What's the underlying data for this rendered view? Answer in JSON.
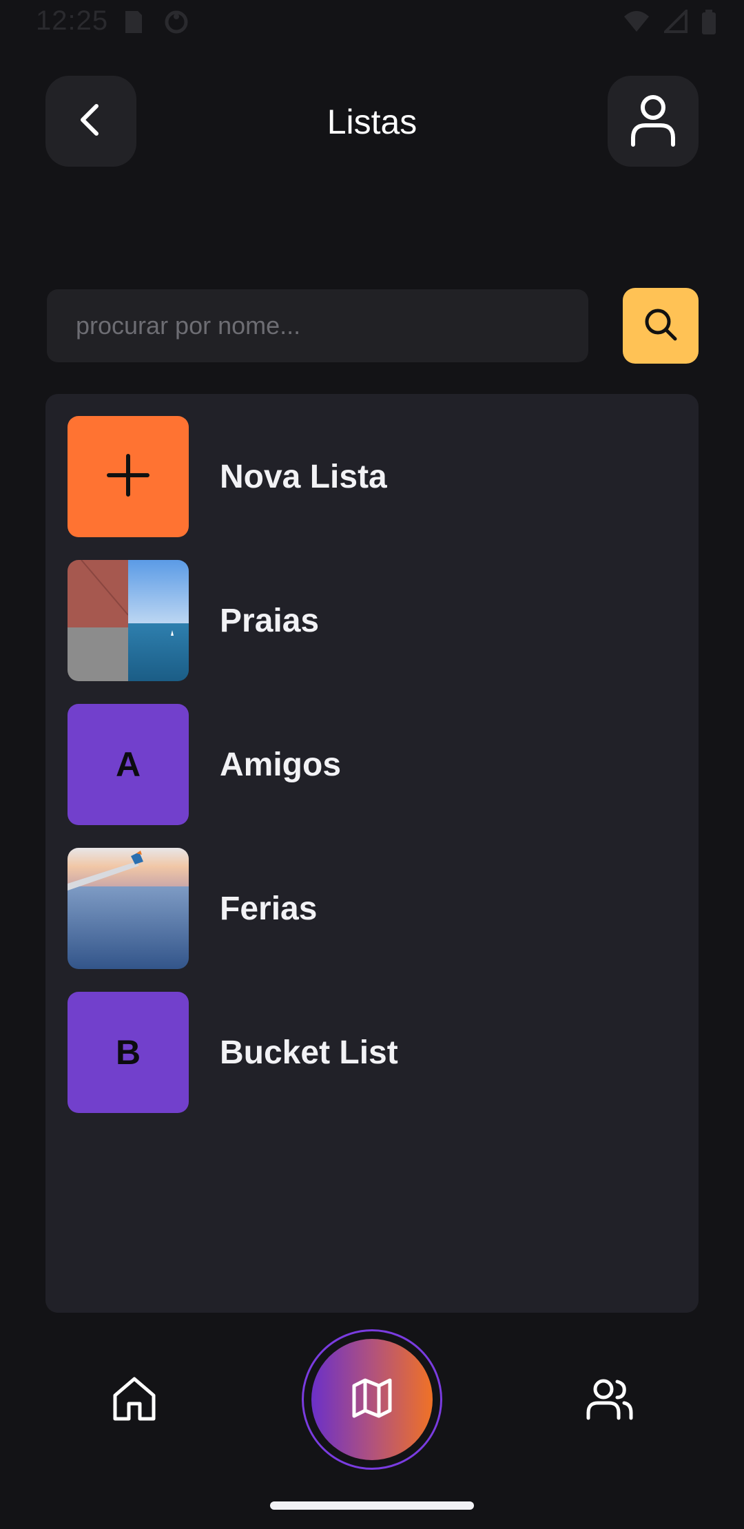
{
  "status_bar": {
    "time": "12:25",
    "left_icons": [
      "sd-card-icon",
      "sync-icon"
    ],
    "right_icons": [
      "wifi-icon",
      "cell-signal-icon",
      "battery-icon"
    ]
  },
  "header": {
    "title": "Listas",
    "back_icon": "chevron-left-icon",
    "profile_icon": "user-icon"
  },
  "search": {
    "placeholder": "procurar por nome...",
    "value": "",
    "button_icon": "search-icon"
  },
  "lists": [
    {
      "label": "Nova Lista",
      "thumb_type": "action",
      "icon": "plus-icon",
      "color": "#ff7332"
    },
    {
      "label": "Praias",
      "thumb_type": "photo-collage"
    },
    {
      "label": "Amigos",
      "thumb_type": "letter",
      "letter": "A",
      "color": "#7240cc"
    },
    {
      "label": "Ferias",
      "thumb_type": "photo"
    },
    {
      "label": "Bucket List",
      "thumb_type": "letter",
      "letter": "B",
      "color": "#7240cc"
    }
  ],
  "bottom_nav": {
    "items": [
      "home-icon",
      "map-icon",
      "users-icon"
    ],
    "active": "map-icon"
  },
  "colors": {
    "background": "#131316",
    "panel": "#212128",
    "accent_yellow": "#ffc255",
    "accent_orange": "#ff7332",
    "accent_purple": "#7240cc"
  }
}
